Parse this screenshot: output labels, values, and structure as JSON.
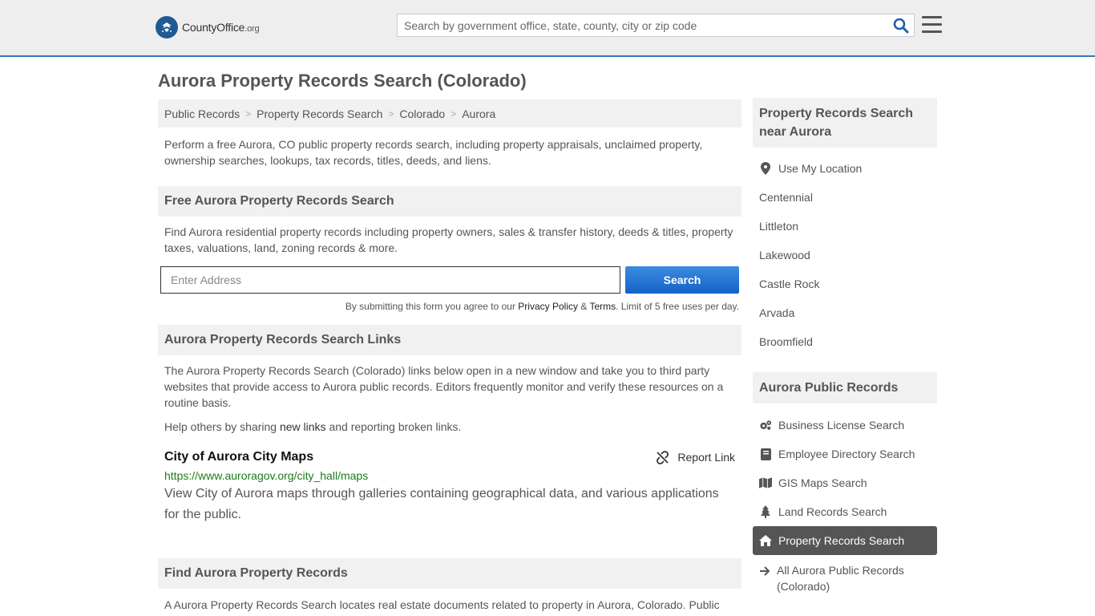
{
  "header": {
    "logo_main": "CountyOffice",
    "logo_tld": ".org",
    "search_placeholder": "Search by government office, state, county, city or zip code"
  },
  "page": {
    "title": "Aurora Property Records Search (Colorado)",
    "breadcrumb": [
      "Public Records",
      "Property Records Search",
      "Colorado",
      "Aurora"
    ],
    "intro": "Perform a free Aurora, CO public property records search, including property appraisals, unclaimed property, ownership searches, lookups, tax records, titles, deeds, and liens."
  },
  "free_search": {
    "heading": "Free Aurora Property Records Search",
    "description": "Find Aurora residential property records including property owners, sales & transfer history, deeds & titles, property taxes, valuations, land, zoning records & more.",
    "address_placeholder": "Enter Address",
    "button": "Search",
    "disclaimer_pre": "By submitting this form you agree to our",
    "privacy": "Privacy Policy",
    "amp": "&",
    "terms": "Terms",
    "disclaimer_post": ". Limit of 5 free uses per day."
  },
  "links_section": {
    "heading": "Aurora Property Records Search Links",
    "description": "The Aurora Property Records Search (Colorado) links below open in a new window and take you to third party websites that provide access to Aurora public records. Editors frequently monitor and verify these resources on a routine basis.",
    "help_pre": "Help others by sharing",
    "help_link": "new links",
    "help_post": "and reporting broken links.",
    "links": [
      {
        "title": "City of Aurora City Maps",
        "url": "https://www.auroragov.org/city_hall/maps",
        "description": "View City of Aurora maps through galleries containing geographical data, and various applications for the public.",
        "report": "Report Link"
      }
    ]
  },
  "find_section": {
    "heading": "Find Aurora Property Records",
    "text": "A Aurora Property Records Search locates real estate documents related to property in Aurora, Colorado. Public"
  },
  "sidebar": {
    "near_heading": "Property Records Search near Aurora",
    "use_location": "Use My Location",
    "nearby": [
      "Centennial",
      "Littleton",
      "Lakewood",
      "Castle Rock",
      "Arvada",
      "Broomfield"
    ],
    "records_heading": "Aurora Public Records",
    "records": [
      {
        "label": "Business License Search",
        "icon": "gears-icon"
      },
      {
        "label": "Employee Directory Search",
        "icon": "book-icon"
      },
      {
        "label": "GIS Maps Search",
        "icon": "map-icon"
      },
      {
        "label": "Land Records Search",
        "icon": "tree-icon"
      },
      {
        "label": "Property Records Search",
        "icon": "home-icon",
        "active": true
      },
      {
        "label": "All Aurora Public Records (Colorado)",
        "icon": "arrow-right-icon"
      }
    ]
  }
}
